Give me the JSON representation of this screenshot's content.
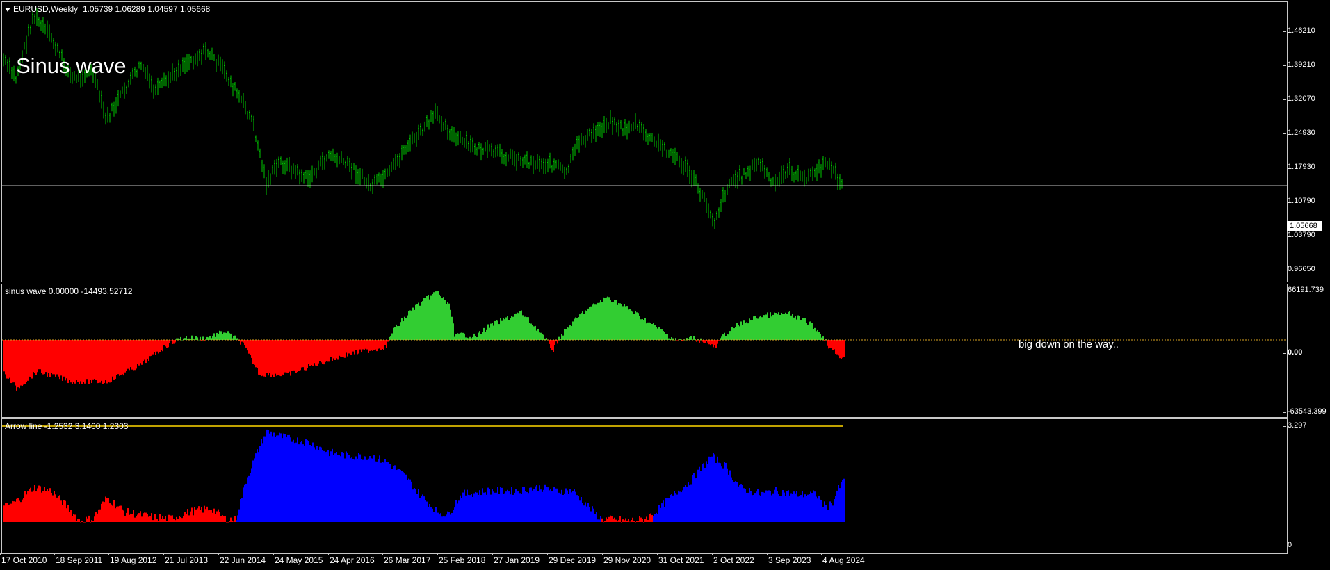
{
  "main_pane": {
    "header_symbol": "EURUSD,Weekly",
    "header_ohlc": "1.05739 1.06289 1.04597 1.05668",
    "big_label": "Sinus wave",
    "y_ticks": [
      "1.46210",
      "1.39210",
      "1.32070",
      "1.24930",
      "1.17930",
      "1.10790",
      "1.03790",
      "0.96650"
    ],
    "current_price": "1.05668",
    "colors": {
      "bars": "#00c800",
      "price_line": "#c0c0c0"
    }
  },
  "sine_pane": {
    "header": "sinus wave 0.00000 -14493.52712",
    "y_ticks": [
      "66191.739",
      "0.00",
      "-63543.399"
    ],
    "annotation": "big down on the way..",
    "colors": {
      "positive": "#32cd32",
      "negative": "#ff0000",
      "zero_line": "#daa520"
    }
  },
  "arrow_pane": {
    "header": "Arrow line -1.2532 3.1400 1.2303",
    "y_ticks": [
      "3.297",
      "0"
    ],
    "colors": {
      "positive": "#0000ff",
      "negative": "#ff0000",
      "line": "#ffd700"
    }
  },
  "x_axis": {
    "labels": [
      "17 Oct 2010",
      "18 Sep 2011",
      "19 Aug 2012",
      "21 Jul 2013",
      "22 Jun 2014",
      "24 May 2015",
      "24 Apr 2016",
      "26 Mar 2017",
      "25 Feb 2018",
      "27 Jan 2019",
      "29 Dec 2019",
      "29 Nov 2020",
      "31 Oct 2021",
      "2 Oct 2022",
      "3 Sep 2023",
      "4 Aug 2024"
    ]
  }
}
